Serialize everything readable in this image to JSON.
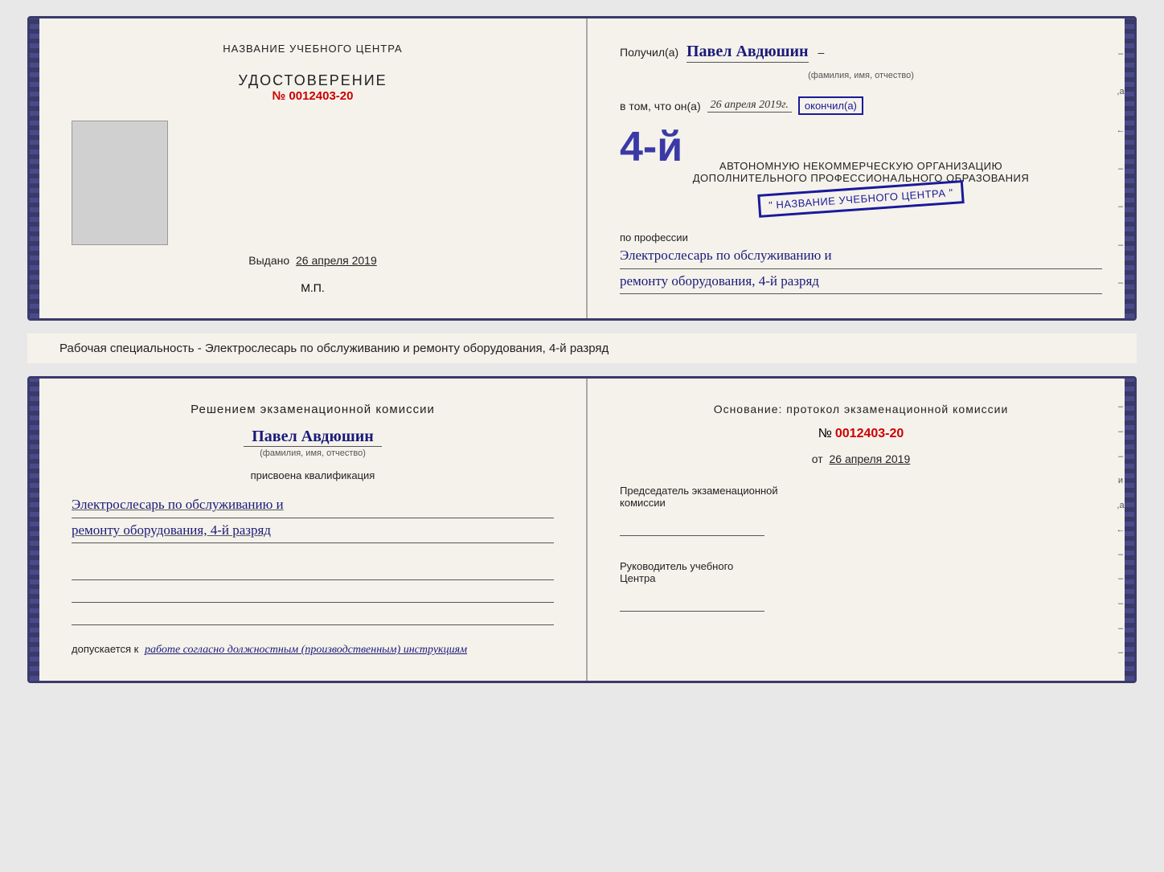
{
  "top_booklet": {
    "left": {
      "center_title": "НАЗВАНИЕ УЧЕБНОГО ЦЕНТРА",
      "udostoverenie_label": "УДОСТОВЕРЕНИЕ",
      "number_prefix": "№",
      "number": "0012403-20",
      "vidan_prefix": "Выдано",
      "vidan_date": "26 апреля 2019",
      "mp_label": "М.П."
    },
    "right": {
      "poluchil_prefix": "Получил(a)",
      "poluchil_name": "Павел Авдюшин",
      "fio_label": "(фамилия, имя, отчество)",
      "vtom_prefix": "в том, что он(а)",
      "vtom_date": "26 апреля 2019г.",
      "okonchil_label": "окончил(а)",
      "rank_text": "4-й",
      "org_line1": "АВТОНОМНУЮ НЕКОММЕРЧЕСКУЮ ОРГАНИЗАЦИЮ",
      "org_line2": "ДОПОЛНИТЕЛЬНОГО ПРОФЕССИОНАЛЬНОГО ОБРАЗОВАНИЯ",
      "org_name": "\" НАЗВАНИЕ УЧЕБНОГО ЦЕНТРА \"",
      "po_professii": "по профессии",
      "profession_line1": "Электрослесарь по обслуживанию и",
      "profession_line2": "ремонту оборудования, 4-й разряд"
    }
  },
  "middle_text": "Рабочая специальность - Электрослесарь по обслуживанию и ремонту оборудования, 4-й разряд",
  "bottom_booklet": {
    "left": {
      "decision_text": "Решением экзаменационной комиссии",
      "name": "Павел Авдюшин",
      "fio_label": "(фамилия, имя, отчество)",
      "prisvoena": "присвоена квалификация",
      "qual_line1": "Электрослесарь по обслуживанию и",
      "qual_line2": "ремонту оборудования, 4-й разряд",
      "dopuskaetsya_prefix": "допускается к",
      "dopuskaetsya_text": "работе согласно должностным (производственным) инструкциям"
    },
    "right": {
      "osnov_text": "Основание: протокол экзаменационной комиссии",
      "number_prefix": "№",
      "number": "0012403-20",
      "from_prefix": "от",
      "from_date": "26 апреля 2019",
      "chairman_line1": "Председатель экзаменационной",
      "chairman_line2": "комиссии",
      "head_line1": "Руководитель учебного",
      "head_line2": "Центра"
    },
    "right_marks": [
      "–",
      "–",
      "–",
      "и",
      ",а",
      "←",
      "–",
      "–",
      "–",
      "–",
      "–"
    ]
  }
}
